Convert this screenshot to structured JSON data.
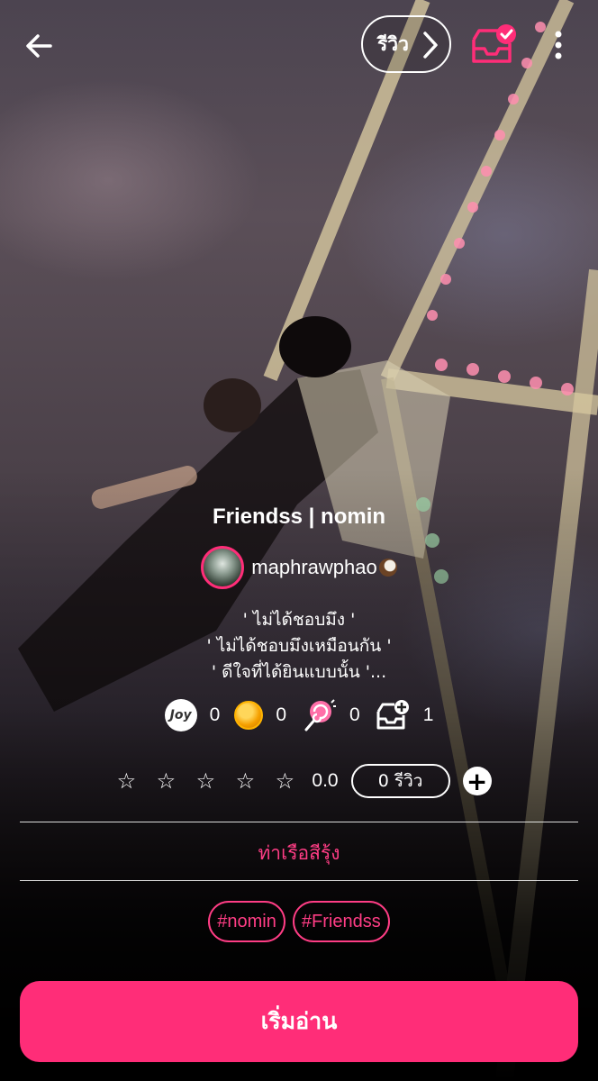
{
  "header": {
    "back_icon": "arrow-left-icon",
    "review_label": "รีวิว",
    "inbox_icon": "inbox-check-icon",
    "more_icon": "more-vertical-icon"
  },
  "story": {
    "title": "Friendss | nomin",
    "author": "maphrawphao",
    "synopsis": [
      "' ไม่ได้ชอบมึง '",
      "' ไม่ได้ชอบมึงเหมือนกัน '",
      "' ดีใจที่ได้ยินแบบนั้น '..."
    ]
  },
  "stats": [
    {
      "icon": "joy-icon",
      "label": "Joy",
      "value": "0"
    },
    {
      "icon": "coin-icon",
      "value": "0"
    },
    {
      "icon": "lollipop-icon",
      "value": "0"
    },
    {
      "icon": "inbox-add-icon",
      "value": "1"
    }
  ],
  "rating": {
    "score": "0.0",
    "review_count": "0 รีวิว"
  },
  "category": "ท่าเรือสีรุ้ง",
  "tags": [
    "#nomin",
    "#Friendss"
  ],
  "start_button": "เริ่มอ่าน",
  "colors": {
    "accent": "#ff2d78"
  }
}
